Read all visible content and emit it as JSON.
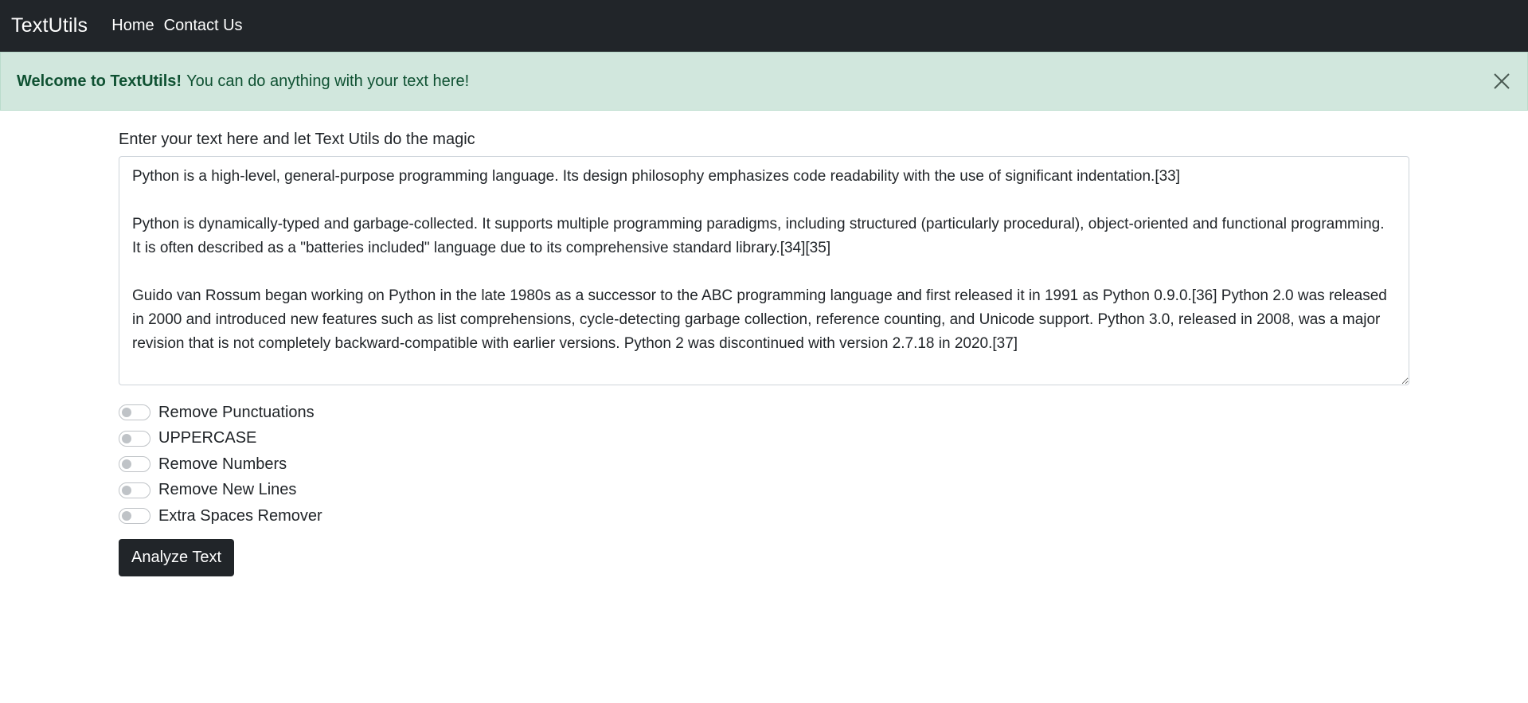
{
  "navbar": {
    "brand": "TextUtils",
    "links": [
      "Home",
      "Contact Us"
    ]
  },
  "alert": {
    "strong": "Welcome to TextUtils!",
    "message": "You can do anything with your text here!",
    "close_icon": "close-icon"
  },
  "form": {
    "label": "Enter your text here and let Text Utils do the magic",
    "text_value": "Python is a high-level, general-purpose programming language. Its design philosophy emphasizes code readability with the use of significant indentation.[33]\n\nPython is dynamically-typed and garbage-collected. It supports multiple programming paradigms, including structured (particularly procedural), object-oriented and functional programming. It is often described as a \"batteries included\" language due to its comprehensive standard library.[34][35]\n\nGuido van Rossum began working on Python in the late 1980s as a successor to the ABC programming language and first released it in 1991 as Python 0.9.0.[36] Python 2.0 was released in 2000 and introduced new features such as list comprehensions, cycle-detecting garbage collection, reference counting, and Unicode support. Python 3.0, released in 2008, was a major revision that is not completely backward-compatible with earlier versions. Python 2 was discontinued with version 2.7.18 in 2020.[37]",
    "switches": [
      {
        "label": "Remove Punctuations",
        "checked": false
      },
      {
        "label": "UPPERCASE",
        "checked": false
      },
      {
        "label": "Remove Numbers",
        "checked": false
      },
      {
        "label": "Remove New Lines",
        "checked": false
      },
      {
        "label": "Extra Spaces Remover",
        "checked": false
      }
    ],
    "submit_label": "Analyze Text"
  },
  "colors": {
    "navbar_bg": "#212529",
    "alert_bg": "#d1e7dd",
    "alert_text": "#0f5132",
    "button_bg": "#212529"
  }
}
